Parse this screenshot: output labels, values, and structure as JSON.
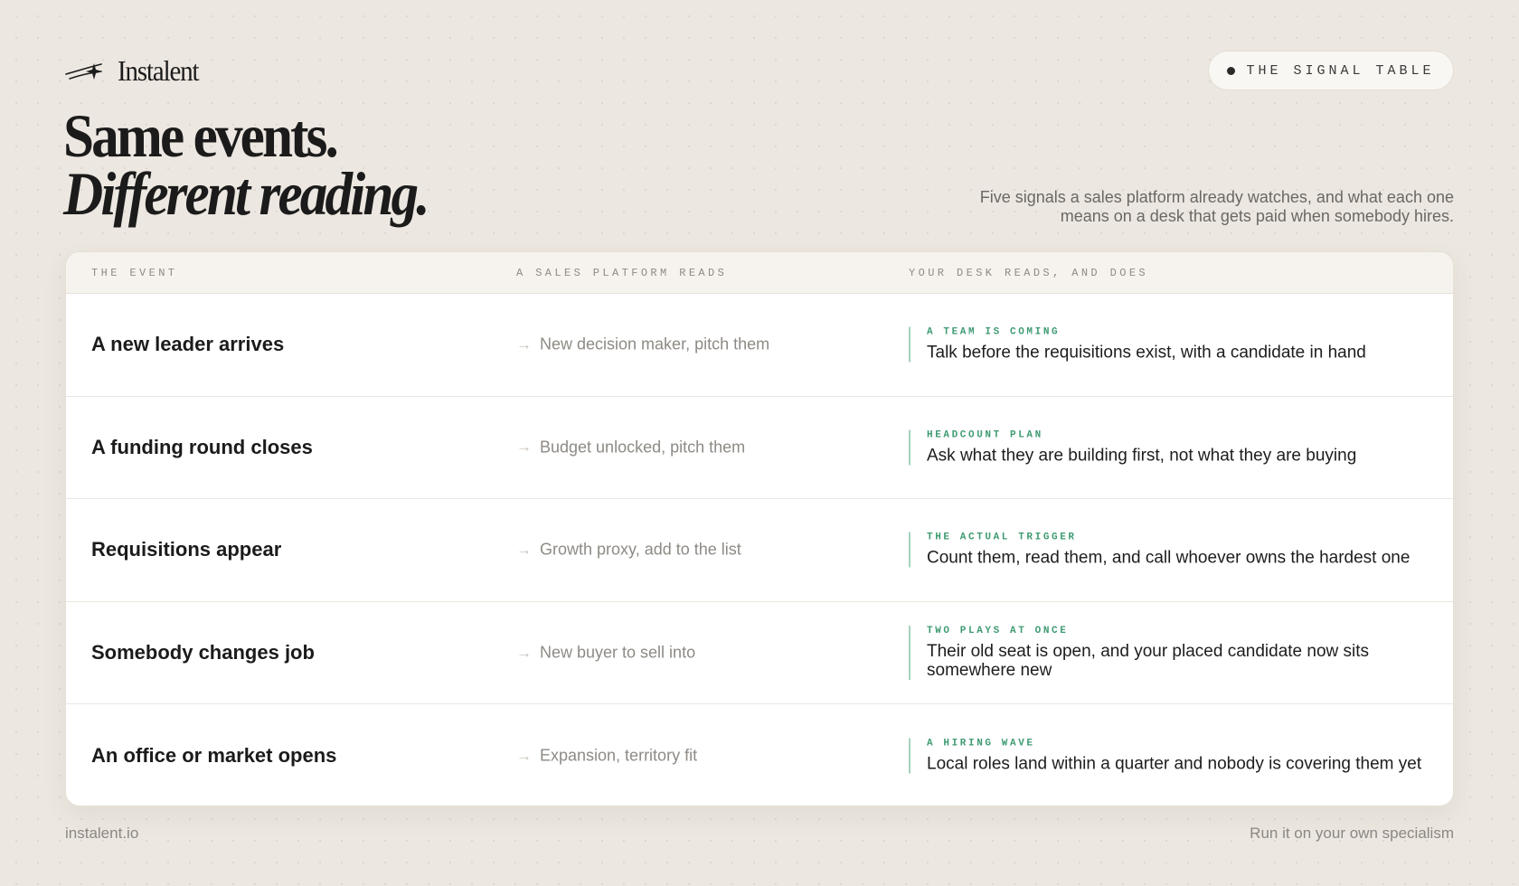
{
  "brand": {
    "name": "Instalent",
    "icon": "swoosh-star-logo-icon"
  },
  "badge": {
    "label": "THE SIGNAL TABLE",
    "icon": "dot-icon"
  },
  "headline": {
    "line1": "Same events.",
    "line2": "Different reading."
  },
  "subtitle": "Five signals a sales platform already watches, and what each one means on a desk that gets paid when somebody hires.",
  "table": {
    "columns": [
      "THE EVENT",
      "A SALES PLATFORM READS",
      "YOUR DESK READS, AND DOES"
    ],
    "rows": [
      {
        "event": "A new leader arrives",
        "sales": "New decision maker, pitch them",
        "tag": "A TEAM IS COMING",
        "action": "Talk before the requisitions exist, with a candidate in hand"
      },
      {
        "event": "A funding round closes",
        "sales": "Budget unlocked, pitch them",
        "tag": "HEADCOUNT PLAN",
        "action": "Ask what they are building first, not what they are buying"
      },
      {
        "event": "Requisitions appear",
        "sales": "Growth proxy, add to the list",
        "tag": "THE ACTUAL TRIGGER",
        "action": "Count them, read them, and call whoever owns the hardest one"
      },
      {
        "event": "Somebody changes job",
        "sales": "New buyer to sell into",
        "tag": "TWO PLAYS AT ONCE",
        "action": "Their old seat is open, and your placed candidate now sits somewhere new"
      },
      {
        "event": "An office or market opens",
        "sales": "Expansion, territory fit",
        "tag": "A HIRING WAVE",
        "action": "Local roles land within a quarter and nobody is covering them yet"
      }
    ],
    "arrow_glyph": "→"
  },
  "footer": {
    "left": "instalent.io",
    "right": "Run it on your own specialism"
  },
  "colors": {
    "background": "#ece7e0",
    "accent_green": "#3f9b72",
    "accent_green_line": "#a6d3bd",
    "text_dark": "#1b1b1b",
    "text_muted": "#8e8a85"
  }
}
